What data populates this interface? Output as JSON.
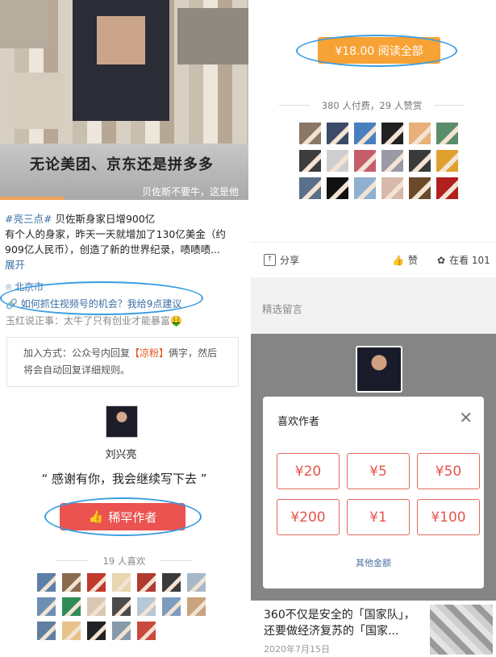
{
  "left": {
    "video": {
      "caption": "无论美团、京东还是拼多多",
      "subtitle": "贝佐斯不要牛，这是他",
      "progress_fraction": 0.26
    },
    "post": {
      "tag": "#亮三点#",
      "headline": "贝佐斯身家日增900亿",
      "body": "有个人的身家，昨天一天就增加了130亿美金（约909亿人民币），创造了新的世界纪录，啧啧啧...",
      "expand": "展开"
    },
    "location": "北京市",
    "link": "如何抓住视频号的机会？我给9点建议",
    "related": "玉红说正事：太牛了只有创业才能暴富🤑",
    "join": {
      "prefix": "加入方式：公众号内回复",
      "keyword": "【凉粉】",
      "suffix": "俩字，然后将会自动回复详细规则。"
    },
    "author": {
      "name": "刘兴亮"
    },
    "thanks": "“ 感谢有你，我会继续写下去 ”",
    "reward_button": "稀罕作者",
    "likes_count": "19 人喜欢",
    "liker_colors": [
      "#5b7fa6",
      "#8a6b4f",
      "#c0392b",
      "#e8d6b0",
      "#b03a2e",
      "#3b3b3b",
      "#a7b8c8",
      "#6d8fb3",
      "#2e8b57",
      "#d9c9b4",
      "#4b4b4b",
      "#b6c7d6",
      "#7c9cbf",
      "#c9a27e",
      "#5e7fa0",
      "#e8c28a",
      "#222222",
      "#8899aa",
      "#c94a3d"
    ]
  },
  "right": {
    "pay_button": "¥18.00 阅读全部",
    "paid_line": "380 人付费，29 人赞赏",
    "payer_colors": [
      "#8a7766",
      "#3b4a66",
      "#4a7fbf",
      "#222222",
      "#e8b07a",
      "#5a8d6a",
      "#3d3d3d",
      "#cfcfcf",
      "#c65d6b",
      "#9a9aa6",
      "#3a3a3a",
      "#e0a030",
      "#5a6f8a",
      "#111111",
      "#8fb0d0",
      "#d8b8a8",
      "#6a4a2a",
      "#b2201d"
    ],
    "actions": {
      "share": "分享",
      "like": "赞",
      "reading": "在看 101"
    },
    "comments_label": "精选留言",
    "modal": {
      "title": "喜欢作者",
      "amounts": [
        "¥20",
        "¥5",
        "¥50",
        "¥200",
        "¥1",
        "¥100"
      ],
      "other": "其他金额"
    },
    "article": {
      "title": "360不仅是安全的「国家队」，还要做经济复苏的「国家...",
      "date": "2020年7月15日"
    }
  }
}
